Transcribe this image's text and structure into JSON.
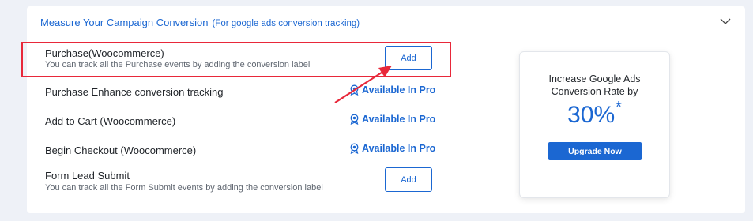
{
  "header": {
    "title": "Measure Your Campaign Conversion",
    "subtitle": "(For google ads conversion tracking)"
  },
  "rows": [
    {
      "title": "Purchase(Woocommerce)",
      "description": "You can track all the Purchase events by adding the conversion label",
      "action": "Add"
    },
    {
      "title": "Purchase Enhance conversion tracking",
      "action": "Available In Pro"
    },
    {
      "title": "Add to Cart (Woocommerce)",
      "action": "Available In Pro"
    },
    {
      "title": "Begin Checkout (Woocommerce)",
      "action": "Available In Pro"
    },
    {
      "title": "Form Lead Submit",
      "description": "You can track all the Form Submit events by adding the conversion label",
      "action": "Add"
    }
  ],
  "promo": {
    "line1": "Increase Google Ads",
    "line2": "Conversion Rate by",
    "percent": "30%",
    "star": "*",
    "button": "Upgrade Now"
  },
  "icons": {
    "header": "chevron-down-icon",
    "pro": "award-badge-icon"
  },
  "colors": {
    "accent": "#1b67d2",
    "highlight": "#e8283a",
    "background": "#eef1f7"
  }
}
